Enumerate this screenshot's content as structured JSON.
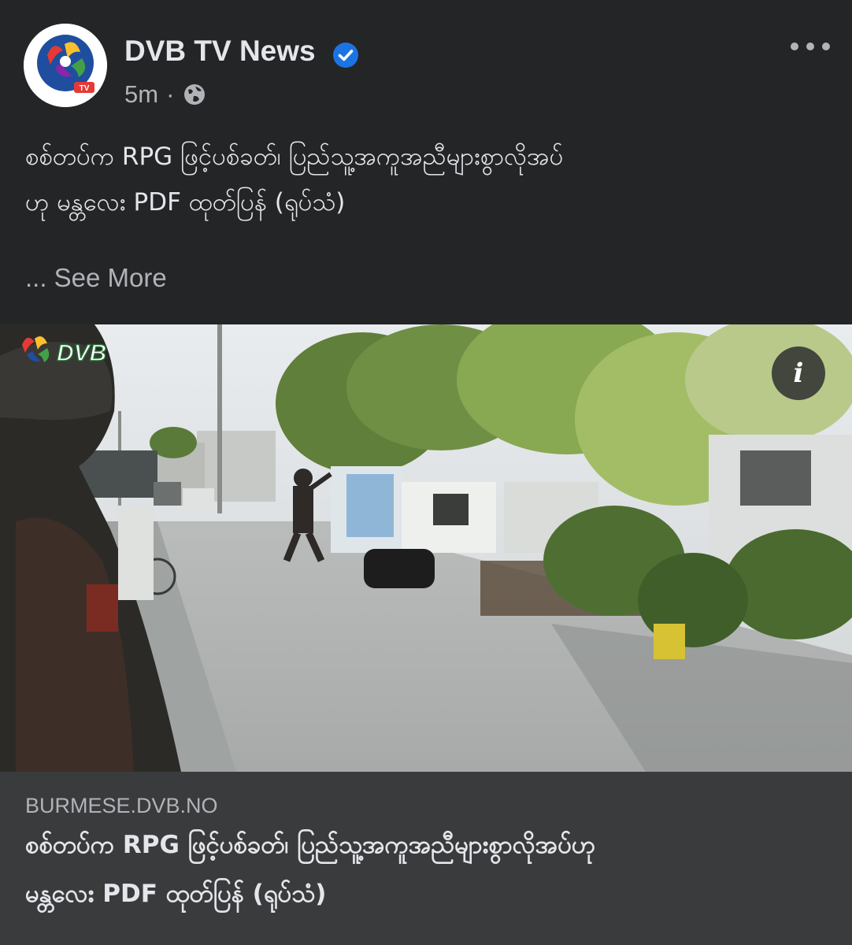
{
  "post": {
    "page_name": "DVB TV News",
    "verified_icon": "verified-badge-icon",
    "timestamp": "5m",
    "separator": "·",
    "audience_icon": "globe-icon",
    "more_icon": "more-dots-icon",
    "text_line_1": "စစ်တပ်က RPG ဖြင့်ပစ်ခတ်၊ ပြည်သူ့အကူအညီများစွာလိုအပ်",
    "text_line_2": "ဟု မန္တလေး PDF ထုတ်ပြန် (ရုပ်သံ)",
    "see_more": "... See More"
  },
  "media": {
    "info_icon": "info-icon",
    "info_glyph": "i",
    "watermark": "DVB"
  },
  "link_preview": {
    "domain": "BURMESE.DVB.NO",
    "title_line_1": "စစ်တပ်က RPG ဖြင့်ပစ်ခတ်၊ ပြည်သူ့အကူအညီများစွာလိုအပ်ဟု",
    "title_line_2": "မန္တလေး PDF ထုတ်ပြန် (ရုပ်သံ)"
  },
  "colors": {
    "background": "#242526",
    "link_preview_bg": "#3a3b3c",
    "primary_text": "#e4e6eb",
    "secondary_text": "#b0b3b8",
    "verified_blue": "#1b74e4"
  }
}
